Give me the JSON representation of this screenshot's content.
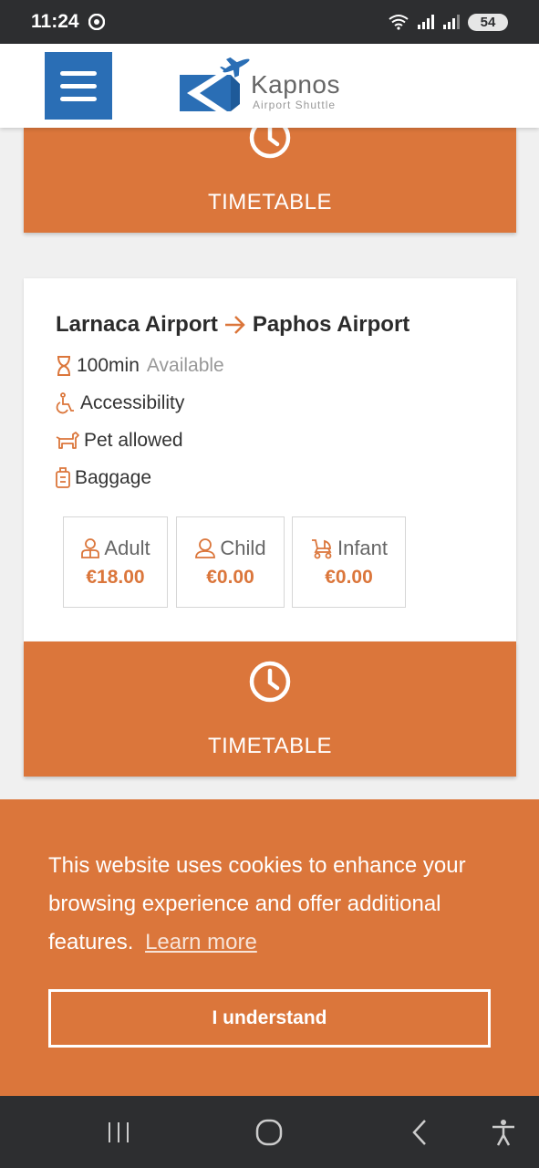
{
  "status_bar": {
    "time": "11:24",
    "battery": "54"
  },
  "header": {
    "logo_name": "Kapnos",
    "logo_sub": "Airport Shuttle",
    "brand_blue": "#2a6eb5"
  },
  "colors": {
    "accent": "#db763b",
    "text": "#333333",
    "muted": "#999999"
  },
  "top_block": {
    "timetable_label": "TIMETABLE"
  },
  "route_card": {
    "from": "Larnaca Airport",
    "to": "Paphos Airport",
    "duration": "100min",
    "availability": "Available",
    "features": [
      "Accessibility",
      "Pet allowed",
      "Baggage"
    ],
    "prices": [
      {
        "type": "Adult",
        "price": "€18.00",
        "icon": "adult-icon"
      },
      {
        "type": "Child",
        "price": "€0.00",
        "icon": "child-icon"
      },
      {
        "type": "Infant",
        "price": "€0.00",
        "icon": "stroller-icon"
      }
    ],
    "timetable_label": "TIMETABLE"
  },
  "cookie_banner": {
    "text": "This website uses cookies to enhance your browsing experience and offer additional features.",
    "learn_more": "Learn more",
    "button": "I understand"
  },
  "nav_bar": {
    "items": [
      "recents-icon",
      "home-icon",
      "back-icon",
      "accessibility-icon"
    ]
  }
}
